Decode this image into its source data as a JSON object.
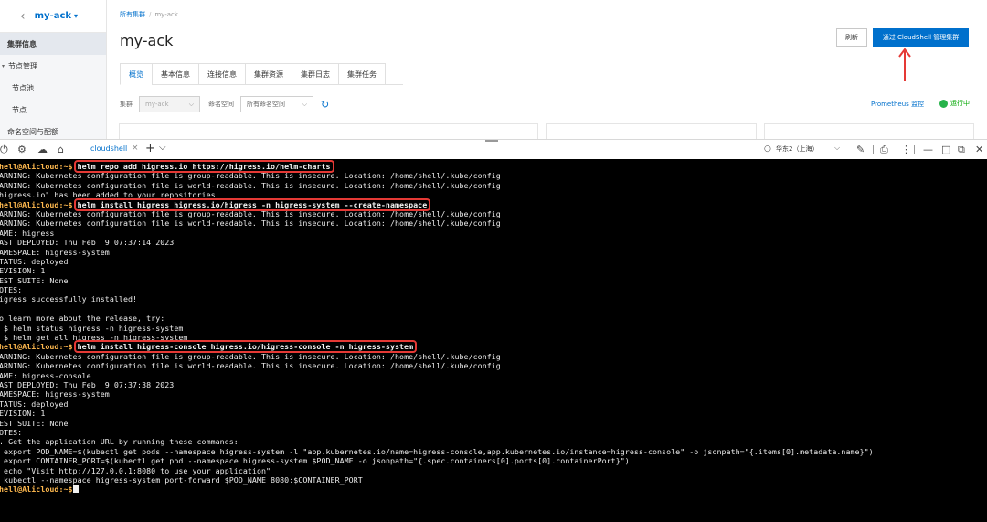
{
  "sidebar": {
    "back_icon": "chevron-left-icon",
    "cluster_name": "my-ack",
    "items": [
      {
        "label": "集群信息",
        "type": "active"
      },
      {
        "label": "节点管理",
        "type": "group"
      },
      {
        "label": "节点池",
        "type": "sub"
      },
      {
        "label": "节点",
        "type": "sub"
      },
      {
        "label": "命名空间与配额",
        "type": "plain"
      }
    ]
  },
  "header": {
    "breadcrumb_root": "所有集群",
    "breadcrumb_sep": "/",
    "breadcrumb_current": "my-ack",
    "title": "my-ack",
    "refresh_label": "刷新",
    "cloudshell_label": "通过 CloudShell 管理集群"
  },
  "tabs": [
    "概览",
    "基本信息",
    "连接信息",
    "集群资源",
    "集群日志",
    "集群任务"
  ],
  "filters": {
    "cluster_label": "集群",
    "cluster_value": "my-ack",
    "namespace_label": "命名空间",
    "namespace_value": "所有命名空间",
    "prometheus_label": "Prometheus 监控",
    "status_label": "运行中"
  },
  "shell_bar": {
    "tab_label": "cloudshell",
    "region_label": "华东2（上海）",
    "icons": [
      "power-icon",
      "settings-icon",
      "cloud-upload-icon",
      "car-icon",
      "pen-icon",
      "print-icon",
      "more-icon",
      "minimize-icon",
      "maximize-icon",
      "restore-icon",
      "close-icon"
    ]
  },
  "colors": {
    "accent": "#0070cc",
    "prompt": "#ffb94e",
    "highlight_box": "#e53935",
    "status_green": "#27b34b"
  },
  "terminal": {
    "prompt_text": "hell@Alicloud:~$",
    "lines": [
      {
        "kind": "cmd",
        "text": "helm repo add higress.io https://higress.io/helm-charts",
        "boxed": true
      },
      {
        "kind": "out",
        "text": "ARNING: Kubernetes configuration file is group-readable. This is insecure. Location: /home/shell/.kube/config"
      },
      {
        "kind": "out",
        "text": "ARNING: Kubernetes configuration file is world-readable. This is insecure. Location: /home/shell/.kube/config"
      },
      {
        "kind": "out",
        "text": "higress.io\" has been added to your repositories"
      },
      {
        "kind": "cmd",
        "text": "helm install higress higress.io/higress -n higress-system --create-namespace",
        "boxed": true
      },
      {
        "kind": "out",
        "text": "ARNING: Kubernetes configuration file is group-readable. This is insecure. Location: /home/shell/.kube/config"
      },
      {
        "kind": "out",
        "text": "ARNING: Kubernetes configuration file is world-readable. This is insecure. Location: /home/shell/.kube/config"
      },
      {
        "kind": "out",
        "text": "AME: higress"
      },
      {
        "kind": "out",
        "text": "AST DEPLOYED: Thu Feb  9 07:37:14 2023"
      },
      {
        "kind": "out",
        "text": "AMESPACE: higress-system"
      },
      {
        "kind": "out",
        "text": "TATUS: deployed"
      },
      {
        "kind": "out",
        "text": "EVISION: 1"
      },
      {
        "kind": "out",
        "text": "EST SUITE: None"
      },
      {
        "kind": "out",
        "text": "OTES:"
      },
      {
        "kind": "out",
        "text": "igress successfully installed!"
      },
      {
        "kind": "out",
        "text": ""
      },
      {
        "kind": "out",
        "text": "o learn more about the release, try:"
      },
      {
        "kind": "out",
        "text": " $ helm status higress -n higress-system"
      },
      {
        "kind": "out",
        "text": " $ helm get all higress -n higress-system"
      },
      {
        "kind": "cmd",
        "text": "helm install higress-console higress.io/higress-console -n higress-system",
        "boxed": true
      },
      {
        "kind": "out",
        "text": "ARNING: Kubernetes configuration file is group-readable. This is insecure. Location: /home/shell/.kube/config"
      },
      {
        "kind": "out",
        "text": "ARNING: Kubernetes configuration file is world-readable. This is insecure. Location: /home/shell/.kube/config"
      },
      {
        "kind": "out",
        "text": "AME: higress-console"
      },
      {
        "kind": "out",
        "text": "AST DEPLOYED: Thu Feb  9 07:37:38 2023"
      },
      {
        "kind": "out",
        "text": "AMESPACE: higress-system"
      },
      {
        "kind": "out",
        "text": "TATUS: deployed"
      },
      {
        "kind": "out",
        "text": "EVISION: 1"
      },
      {
        "kind": "out",
        "text": "EST SUITE: None"
      },
      {
        "kind": "out",
        "text": "OTES:"
      },
      {
        "kind": "out",
        "text": ". Get the application URL by running these commands:"
      },
      {
        "kind": "out",
        "text": " export POD_NAME=$(kubectl get pods --namespace higress-system -l \"app.kubernetes.io/name=higress-console,app.kubernetes.io/instance=higress-console\" -o jsonpath=\"{.items[0].metadata.name}\")"
      },
      {
        "kind": "out",
        "text": " export CONTAINER_PORT=$(kubectl get pod --namespace higress-system $POD_NAME -o jsonpath=\"{.spec.containers[0].ports[0].containerPort}\")"
      },
      {
        "kind": "out",
        "text": " echo \"Visit http://127.0.0.1:8080 to use your application\""
      },
      {
        "kind": "out",
        "text": " kubectl --namespace higress-system port-forward $POD_NAME 8080:$CONTAINER_PORT"
      },
      {
        "kind": "cmd",
        "text": "",
        "boxed": false,
        "cursor": true
      }
    ]
  }
}
